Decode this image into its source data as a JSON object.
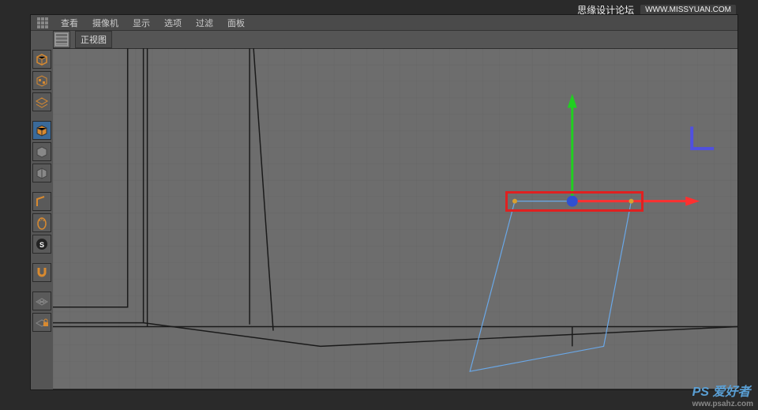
{
  "watermark": {
    "top_text": "思缘设计论坛",
    "top_url": "WWW.MISSYUAN.COM",
    "bottom_brand": "PS 爱好者",
    "bottom_url": "www.psahz.com"
  },
  "menu": {
    "items": [
      "查看",
      "摄像机",
      "显示",
      "选项",
      "过滤",
      "面板"
    ]
  },
  "panel": {
    "view_label": "正视图"
  },
  "tools": {
    "names": [
      "cube",
      "checker",
      "grid",
      "model",
      "cube2",
      "cube3",
      "edge",
      "point",
      "scale",
      "snap",
      "workplane",
      "lock-grid"
    ]
  },
  "colors": {
    "x_axis": "#ff3030",
    "y_axis": "#20d020",
    "z_axis": "#4040ff",
    "selection": "#6aa8e8",
    "highlight": "#e02020",
    "tool_icon": "#d88a30"
  }
}
